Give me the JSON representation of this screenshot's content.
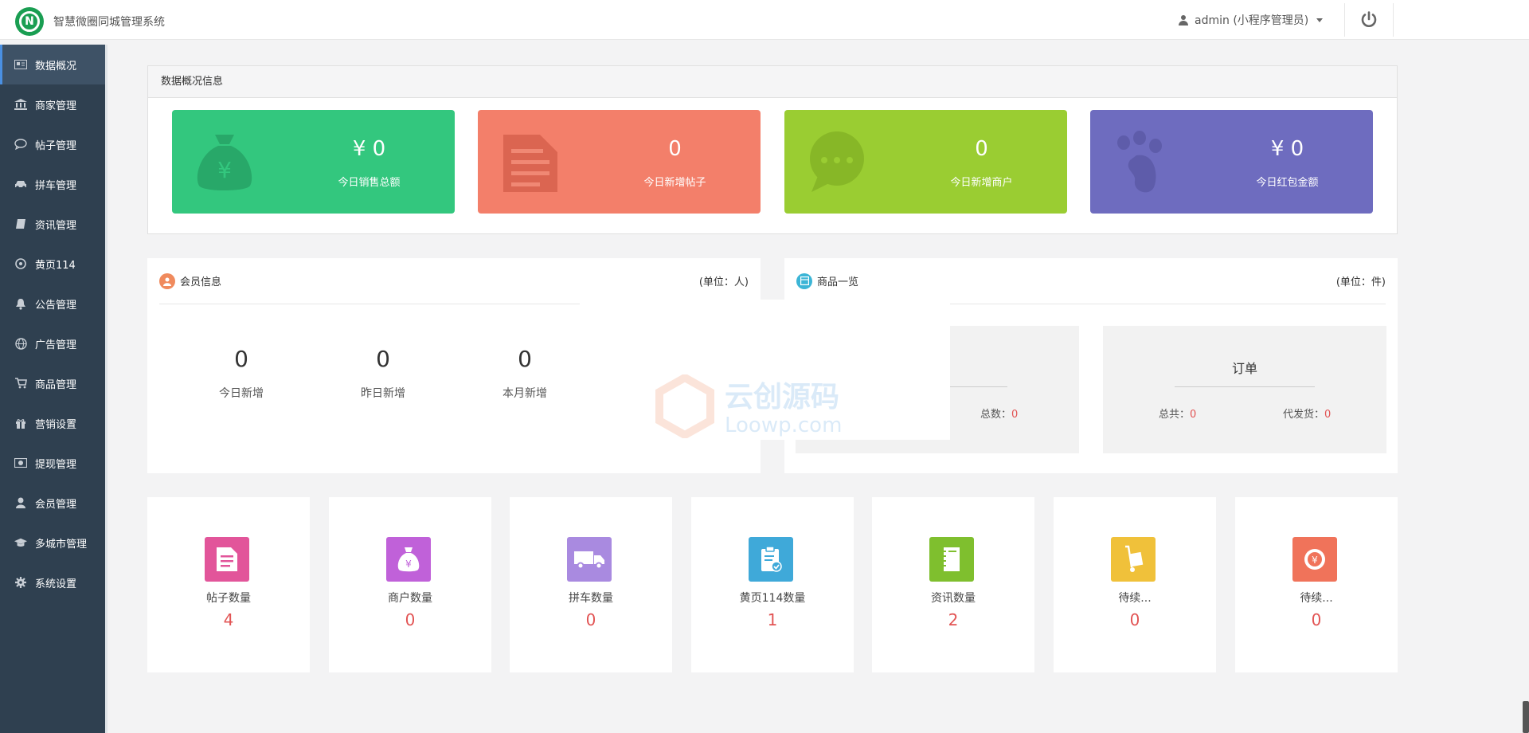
{
  "header": {
    "app_title": "智慧微圈同城管理系统",
    "user_label": "admin (小程序管理员)"
  },
  "sidebar": {
    "items": [
      {
        "label": "数据概况",
        "icon": "id-card-icon"
      },
      {
        "label": "商家管理",
        "icon": "bank-icon"
      },
      {
        "label": "帖子管理",
        "icon": "comment-icon"
      },
      {
        "label": "拼车管理",
        "icon": "car-icon"
      },
      {
        "label": "资讯管理",
        "icon": "book-icon"
      },
      {
        "label": "黄页114",
        "icon": "compass-icon"
      },
      {
        "label": "公告管理",
        "icon": "bell-icon"
      },
      {
        "label": "广告管理",
        "icon": "globe-icon"
      },
      {
        "label": "商品管理",
        "icon": "cart-icon"
      },
      {
        "label": "营销设置",
        "icon": "gift-icon"
      },
      {
        "label": "提现管理",
        "icon": "money-icon"
      },
      {
        "label": "会员管理",
        "icon": "user-icon"
      },
      {
        "label": "多城市管理",
        "icon": "graduation-cap-icon"
      },
      {
        "label": "系统设置",
        "icon": "gear-icon"
      }
    ]
  },
  "overview": {
    "title": "数据概况信息",
    "cards": [
      {
        "value": "¥ 0",
        "label": "今日销售总额",
        "color": "#33c77e"
      },
      {
        "value": "0",
        "label": "今日新增帖子",
        "color": "#f37f6a"
      },
      {
        "value": "0",
        "label": "今日新增商户",
        "color": "#9acd32"
      },
      {
        "value": "¥ 0",
        "label": "今日红包金额",
        "color": "#6e6cbf"
      }
    ]
  },
  "members": {
    "title": "会员信息",
    "unit": "(单位：人)",
    "stats": [
      {
        "value": "0",
        "label": "今日新增"
      },
      {
        "value": "0",
        "label": "昨日新增"
      },
      {
        "value": "0",
        "label": "本月新增"
      }
    ]
  },
  "goods": {
    "title": "商品一览",
    "unit": "(单位：件)",
    "left_box": {
      "total_label": "总数：",
      "total_value": "0"
    },
    "order_box": {
      "title": "订单",
      "total_label": "总共：",
      "total_value": "0",
      "pending_label": "代发货：",
      "pending_value": "0"
    }
  },
  "counts": [
    {
      "label": "帖子数量",
      "value": "4",
      "color": "#e2559a",
      "icon": "document-icon"
    },
    {
      "label": "商户数量",
      "value": "0",
      "color": "#c061d9",
      "icon": "money-bag-icon"
    },
    {
      "label": "拼车数量",
      "value": "0",
      "color": "#a98ae0",
      "icon": "truck-icon"
    },
    {
      "label": "黄页114数量",
      "value": "1",
      "color": "#3fa9d9",
      "icon": "clipboard-check-icon"
    },
    {
      "label": "资讯数量",
      "value": "2",
      "color": "#7fbf2e",
      "icon": "notebook-icon"
    },
    {
      "label": "待续...",
      "value": "0",
      "color": "#f0c13a",
      "icon": "hand-truck-icon"
    },
    {
      "label": "待续...",
      "value": "0",
      "color": "#f0735a",
      "icon": "yen-coin-icon"
    }
  ],
  "watermark": {
    "line1": "云创源码",
    "line2": "Loowp.com"
  }
}
